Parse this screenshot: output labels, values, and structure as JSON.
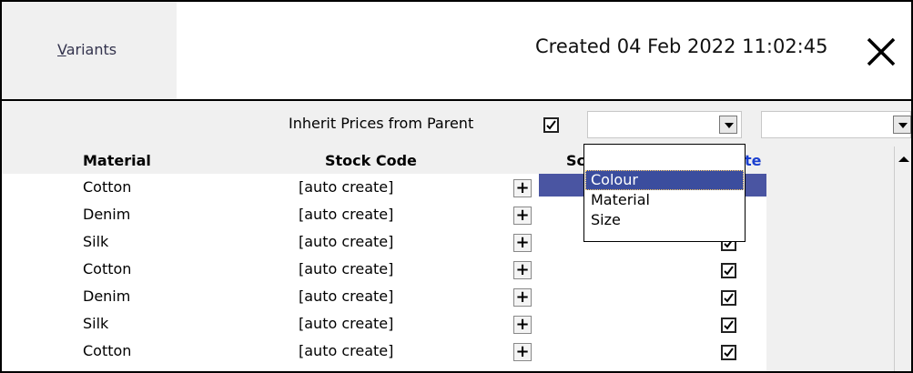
{
  "header": {
    "tab_label_first": "V",
    "tab_label_rest": "ariants",
    "created_text": "Created 04 Feb 2022 11:02:45",
    "close_icon": "close-icon"
  },
  "toolbar": {
    "inherit_label": "Inherit Prices from Parent",
    "inherit_checked": true,
    "combo1_value": "",
    "combo2_value": ""
  },
  "columns": {
    "material": "Material",
    "stock_code": "Stock Code",
    "col3_partial": "Sc",
    "col4_partial": "te"
  },
  "rows": [
    {
      "material": "Cotton",
      "stock_code": "[auto create]",
      "plus": "+",
      "checked": true
    },
    {
      "material": "Denim",
      "stock_code": "[auto create]",
      "plus": "+",
      "checked": true
    },
    {
      "material": "Silk",
      "stock_code": "[auto create]",
      "plus": "+",
      "checked": true
    },
    {
      "material": "Cotton",
      "stock_code": "[auto create]",
      "plus": "+",
      "checked": true
    },
    {
      "material": "Denim",
      "stock_code": "[auto create]",
      "plus": "+",
      "checked": true
    },
    {
      "material": "Silk",
      "stock_code": "[auto create]",
      "plus": "+",
      "checked": true
    },
    {
      "material": "Cotton",
      "stock_code": "[auto create]",
      "plus": "+",
      "checked": true
    }
  ],
  "dropdown": {
    "items": [
      "Colour",
      "Material",
      "Size"
    ],
    "selected": "Colour"
  },
  "colors": {
    "selection": "#3b4d9e",
    "header_link": "#1a3fd0",
    "panel_bg": "#f0f0f0"
  }
}
